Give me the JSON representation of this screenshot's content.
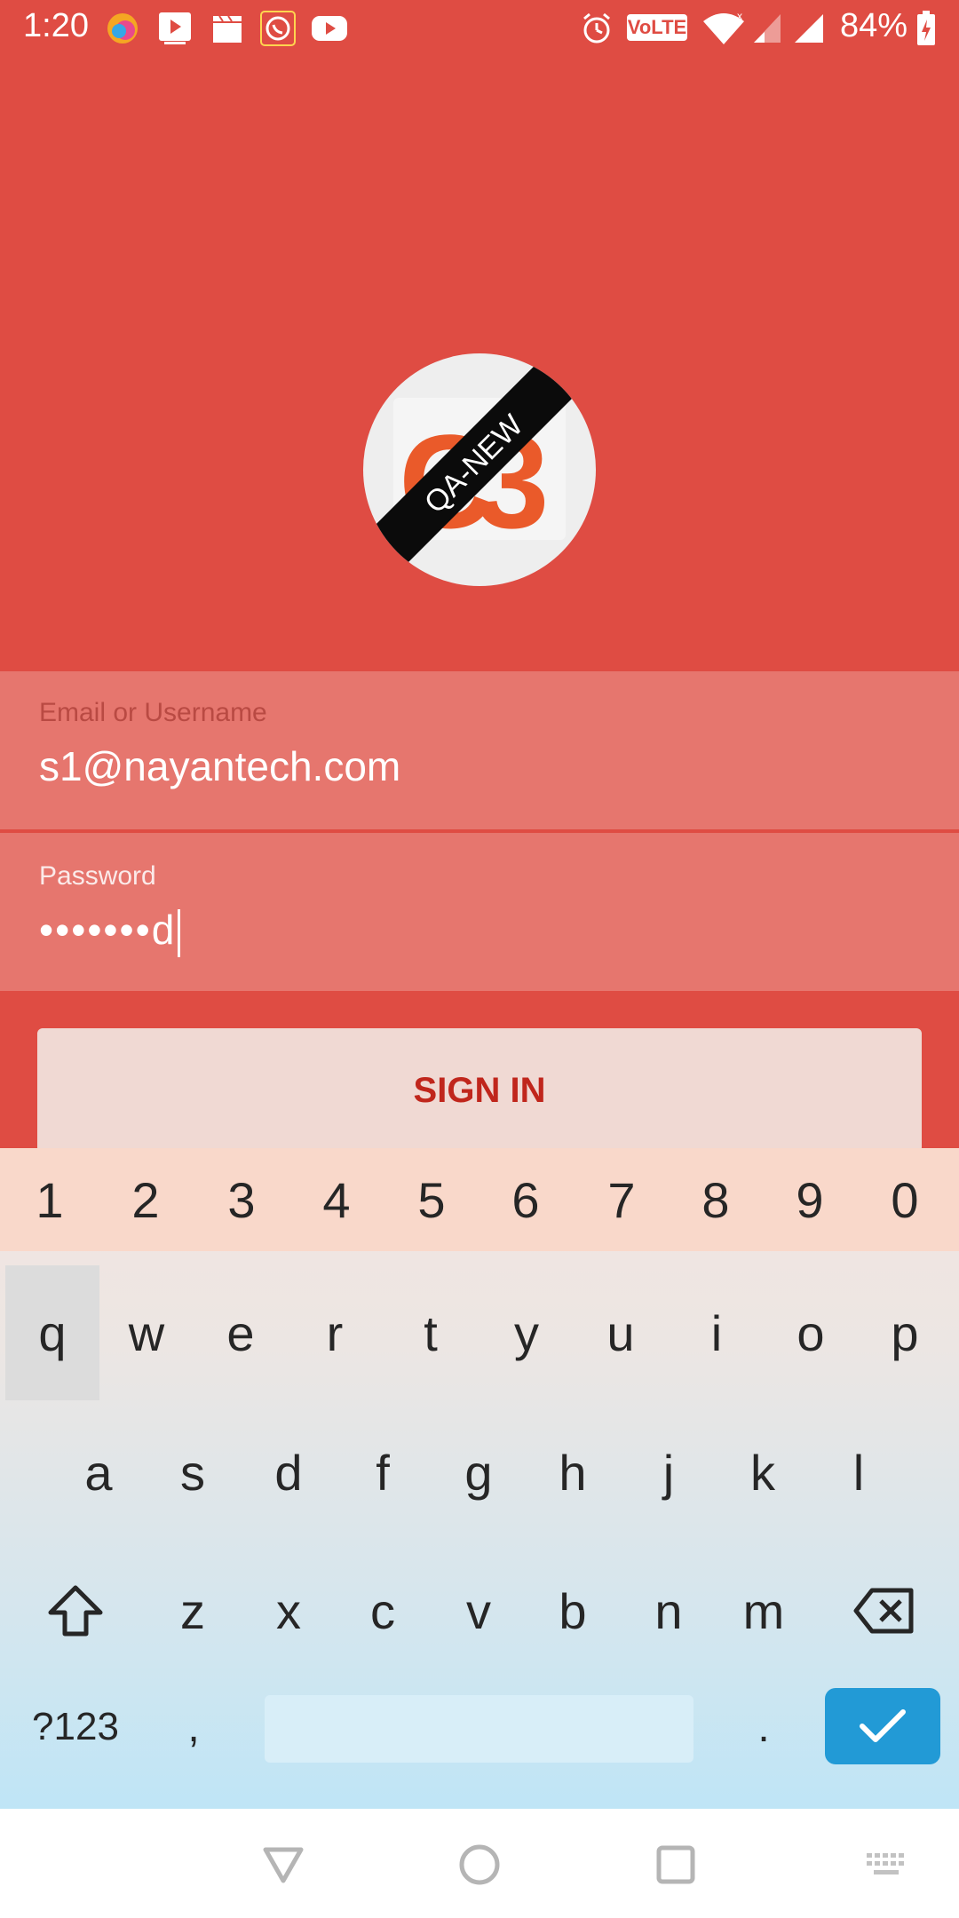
{
  "status_bar": {
    "time": "1:20",
    "battery": "84%",
    "network_badge": "VoLTE"
  },
  "logo": {
    "ribbon_text": "QA-NEW",
    "mark_text": "S",
    "mark_digits": "3"
  },
  "form": {
    "email_label": "Email or Username",
    "email_value": "s1@nayantech.com",
    "password_label": "Password",
    "password_value": "•••••••d",
    "signin_label": "SIGN IN"
  },
  "keyboard": {
    "numbers": [
      "1",
      "2",
      "3",
      "4",
      "5",
      "6",
      "7",
      "8",
      "9",
      "0"
    ],
    "row1": [
      "q",
      "w",
      "e",
      "r",
      "t",
      "y",
      "u",
      "i",
      "o",
      "p"
    ],
    "row2": [
      "a",
      "s",
      "d",
      "f",
      "g",
      "h",
      "j",
      "k",
      "l"
    ],
    "row3": [
      "z",
      "x",
      "c",
      "v",
      "b",
      "n",
      "m"
    ],
    "symbols_key": "?123",
    "comma_key": ",",
    "period_key": "."
  },
  "colors": {
    "background": "#df4c43",
    "field": "#e6766e",
    "signin_text": "#c0261c",
    "enter_key": "#229ad6"
  }
}
